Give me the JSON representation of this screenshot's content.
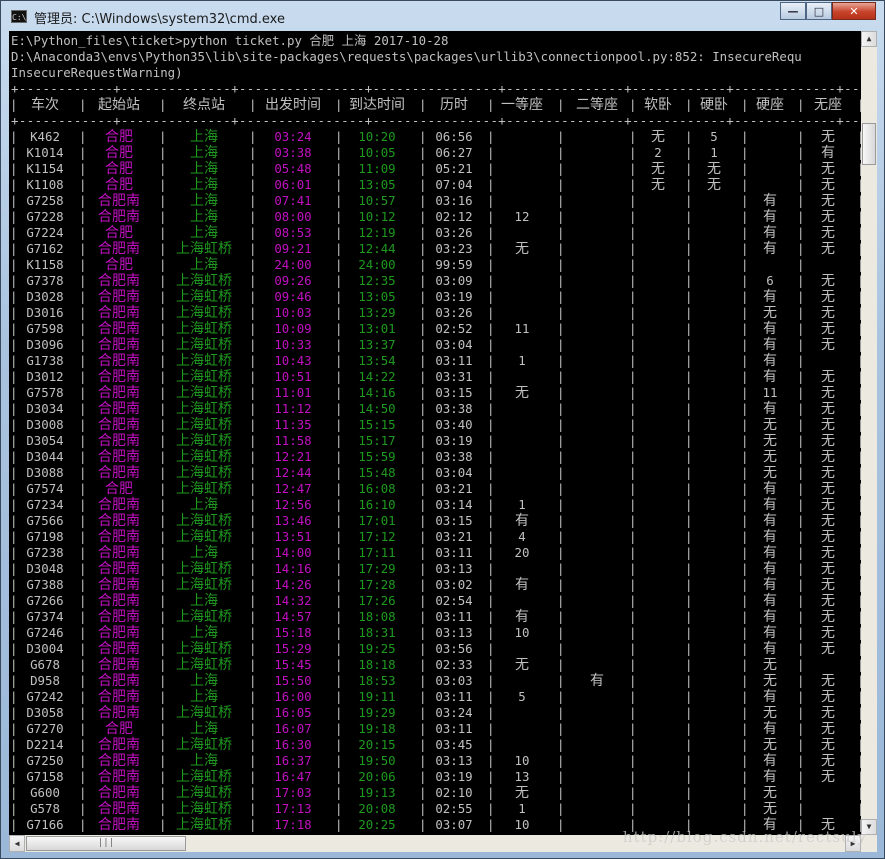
{
  "window": {
    "title": "管理员: C:\\Windows\\system32\\cmd.exe",
    "icon_text": "C:\\",
    "buttons": {
      "minimize": "—",
      "maximize": "□",
      "close": "✕"
    }
  },
  "console": {
    "command": "E:\\Python_files\\ticket>python ticket.py 合肥 上海 2017-10-28",
    "warning_line1": "D:\\Anaconda3\\envs\\Python35\\lib\\site-packages\\requests\\packages\\urllib3\\connectionpool.py:852: InsecureRequ",
    "warning_line2": "  InsecureRequestWarning)",
    "separator": "+------------+--------------+----------------+----------------+---------------+------------+-------------+-------------+---------+---------+---------+----------+",
    "headers": [
      "车次",
      "起始站",
      "终点站",
      "出发时间",
      "到达时间",
      "历时",
      "一等座",
      "二等座",
      "软卧",
      "硬卧",
      "硬座",
      "无座"
    ],
    "rows": [
      [
        "K462",
        "合肥",
        "上海",
        "03:24",
        "10:20",
        "06:56",
        "",
        "",
        "无",
        "5",
        "",
        "无"
      ],
      [
        "K1014",
        "合肥",
        "上海",
        "03:38",
        "10:05",
        "06:27",
        "",
        "",
        "2",
        "1",
        "",
        "有"
      ],
      [
        "K1154",
        "合肥",
        "上海",
        "05:48",
        "11:09",
        "05:21",
        "",
        "",
        "无",
        "无",
        "",
        "无"
      ],
      [
        "K1108",
        "合肥",
        "上海",
        "06:01",
        "13:05",
        "07:04",
        "",
        "",
        "无",
        "无",
        "",
        "无"
      ],
      [
        "G7258",
        "合肥南",
        "上海",
        "07:41",
        "10:57",
        "03:16",
        "",
        "",
        "",
        "",
        "有",
        "无"
      ],
      [
        "G7228",
        "合肥南",
        "上海",
        "08:00",
        "10:12",
        "02:12",
        "12",
        "",
        "",
        "",
        "有",
        "无"
      ],
      [
        "G7224",
        "合肥",
        "上海",
        "08:53",
        "12:19",
        "03:26",
        "",
        "",
        "",
        "",
        "有",
        "无"
      ],
      [
        "G7162",
        "合肥南",
        "上海虹桥",
        "09:21",
        "12:44",
        "03:23",
        "无",
        "",
        "",
        "",
        "有",
        "无"
      ],
      [
        "K1158",
        "合肥",
        "上海",
        "24:00",
        "24:00",
        "99:59",
        "",
        "",
        "",
        "",
        "",
        ""
      ],
      [
        "G7378",
        "合肥南",
        "上海虹桥",
        "09:26",
        "12:35",
        "03:09",
        "",
        "",
        "",
        "",
        "6",
        "无"
      ],
      [
        "D3028",
        "合肥南",
        "上海虹桥",
        "09:46",
        "13:05",
        "03:19",
        "",
        "",
        "",
        "",
        "有",
        "无"
      ],
      [
        "D3016",
        "合肥南",
        "上海虹桥",
        "10:03",
        "13:29",
        "03:26",
        "",
        "",
        "",
        "",
        "无",
        "无"
      ],
      [
        "G7598",
        "合肥南",
        "上海虹桥",
        "10:09",
        "13:01",
        "02:52",
        "11",
        "",
        "",
        "",
        "有",
        "无"
      ],
      [
        "D3096",
        "合肥南",
        "上海虹桥",
        "10:33",
        "13:37",
        "03:04",
        "",
        "",
        "",
        "",
        "有",
        "无"
      ],
      [
        "G1738",
        "合肥南",
        "上海虹桥",
        "10:43",
        "13:54",
        "03:11",
        "1",
        "",
        "",
        "",
        "有",
        ""
      ],
      [
        "D3012",
        "合肥南",
        "上海虹桥",
        "10:51",
        "14:22",
        "03:31",
        "",
        "",
        "",
        "",
        "有",
        "无"
      ],
      [
        "G7578",
        "合肥南",
        "上海虹桥",
        "11:01",
        "14:16",
        "03:15",
        "无",
        "",
        "",
        "",
        "11",
        "无"
      ],
      [
        "D3034",
        "合肥南",
        "上海虹桥",
        "11:12",
        "14:50",
        "03:38",
        "",
        "",
        "",
        "",
        "有",
        "无"
      ],
      [
        "D3008",
        "合肥南",
        "上海虹桥",
        "11:35",
        "15:15",
        "03:40",
        "",
        "",
        "",
        "",
        "无",
        "无"
      ],
      [
        "D3054",
        "合肥南",
        "上海虹桥",
        "11:58",
        "15:17",
        "03:19",
        "",
        "",
        "",
        "",
        "无",
        "无"
      ],
      [
        "D3044",
        "合肥南",
        "上海虹桥",
        "12:21",
        "15:59",
        "03:38",
        "",
        "",
        "",
        "",
        "无",
        "无"
      ],
      [
        "D3088",
        "合肥南",
        "上海虹桥",
        "12:44",
        "15:48",
        "03:04",
        "",
        "",
        "",
        "",
        "无",
        "无"
      ],
      [
        "G7574",
        "合肥",
        "上海虹桥",
        "12:47",
        "16:08",
        "03:21",
        "",
        "",
        "",
        "",
        "有",
        "无"
      ],
      [
        "G7234",
        "合肥南",
        "上海",
        "12:56",
        "16:10",
        "03:14",
        "1",
        "",
        "",
        "",
        "有",
        "无"
      ],
      [
        "G7566",
        "合肥南",
        "上海虹桥",
        "13:46",
        "17:01",
        "03:15",
        "有",
        "",
        "",
        "",
        "有",
        "无"
      ],
      [
        "G7198",
        "合肥南",
        "上海虹桥",
        "13:51",
        "17:12",
        "03:21",
        "4",
        "",
        "",
        "",
        "有",
        "无"
      ],
      [
        "G7238",
        "合肥南",
        "上海",
        "14:00",
        "17:11",
        "03:11",
        "20",
        "",
        "",
        "",
        "有",
        "无"
      ],
      [
        "D3048",
        "合肥南",
        "上海虹桥",
        "14:16",
        "17:29",
        "03:13",
        "",
        "",
        "",
        "",
        "有",
        "无"
      ],
      [
        "G7388",
        "合肥南",
        "上海虹桥",
        "14:26",
        "17:28",
        "03:02",
        "有",
        "",
        "",
        "",
        "有",
        "无"
      ],
      [
        "G7266",
        "合肥南",
        "上海",
        "14:32",
        "17:26",
        "02:54",
        "",
        "",
        "",
        "",
        "有",
        "无"
      ],
      [
        "G7374",
        "合肥南",
        "上海虹桥",
        "14:57",
        "18:08",
        "03:11",
        "有",
        "",
        "",
        "",
        "有",
        "无"
      ],
      [
        "G7246",
        "合肥南",
        "上海",
        "15:18",
        "18:31",
        "03:13",
        "10",
        "",
        "",
        "",
        "有",
        "无"
      ],
      [
        "D3004",
        "合肥南",
        "上海虹桥",
        "15:29",
        "19:25",
        "03:56",
        "",
        "",
        "",
        "",
        "有",
        "无"
      ],
      [
        "G678",
        "合肥南",
        "上海虹桥",
        "15:45",
        "18:18",
        "02:33",
        "无",
        "",
        "",
        "",
        "无",
        ""
      ],
      [
        "D958",
        "合肥南",
        "上海",
        "15:50",
        "18:53",
        "03:03",
        "",
        "有",
        "",
        "",
        "无",
        "无"
      ],
      [
        "G7242",
        "合肥南",
        "上海",
        "16:00",
        "19:11",
        "03:11",
        "5",
        "",
        "",
        "",
        "有",
        "无"
      ],
      [
        "D3058",
        "合肥南",
        "上海虹桥",
        "16:05",
        "19:29",
        "03:24",
        "",
        "",
        "",
        "",
        "无",
        "无"
      ],
      [
        "G7270",
        "合肥",
        "上海",
        "16:07",
        "19:18",
        "03:11",
        "",
        "",
        "",
        "",
        "有",
        "无"
      ],
      [
        "D2214",
        "合肥南",
        "上海虹桥",
        "16:30",
        "20:15",
        "03:45",
        "",
        "",
        "",
        "",
        "无",
        "无"
      ],
      [
        "G7250",
        "合肥南",
        "上海",
        "16:37",
        "19:50",
        "03:13",
        "10",
        "",
        "",
        "",
        "有",
        "无"
      ],
      [
        "G7158",
        "合肥南",
        "上海虹桥",
        "16:47",
        "20:06",
        "03:19",
        "13",
        "",
        "",
        "",
        "有",
        "无"
      ],
      [
        "G600",
        "合肥南",
        "上海虹桥",
        "17:03",
        "19:13",
        "02:10",
        "无",
        "",
        "",
        "",
        "无",
        ""
      ],
      [
        "G578",
        "合肥南",
        "上海虹桥",
        "17:13",
        "20:08",
        "02:55",
        "1",
        "",
        "",
        "",
        "无",
        ""
      ],
      [
        "G7166",
        "合肥南",
        "上海虹桥",
        "17:18",
        "20:25",
        "03:07",
        "10",
        "",
        "",
        "",
        "有",
        "无"
      ]
    ]
  },
  "scrollbars": {
    "up": "▲",
    "down": "▼",
    "left": "◀",
    "right": "▶",
    "grip": "|||"
  },
  "watermark": "http://blog.csdn.net/rectsuly",
  "colors": {
    "background": "#000000",
    "text": "#c0c0c0",
    "magenta": "#c010c0",
    "green": "#1e9a1e"
  }
}
